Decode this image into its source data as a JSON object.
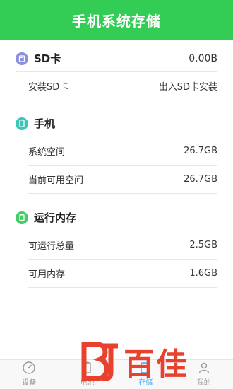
{
  "header": {
    "title": "手机系统存储"
  },
  "sections": [
    {
      "title": "SD卡",
      "value": "0.00B",
      "icon": "sd-card-icon",
      "icon_color": "#8c8fe0",
      "rows": [
        {
          "label": "安装SD卡",
          "value": "出入SD卡安装"
        }
      ]
    },
    {
      "title": "手机",
      "value": "",
      "icon": "phone-icon",
      "icon_color": "#3ec6b8",
      "rows": [
        {
          "label": "系统空间",
          "value": "26.7GB"
        },
        {
          "label": "当前可用空间",
          "value": "26.7GB"
        }
      ]
    },
    {
      "title": "运行内存",
      "value": "",
      "icon": "memory-icon",
      "icon_color": "#44cc66",
      "rows": [
        {
          "label": "可运行总量",
          "value": "2.5GB"
        },
        {
          "label": "可用内存",
          "value": "1.6GB"
        }
      ]
    }
  ],
  "tabbar": {
    "tabs": [
      {
        "label": "设备",
        "icon": "dashboard-icon",
        "active": false
      },
      {
        "label": "电池",
        "icon": "battery-icon",
        "active": false
      },
      {
        "label": "存储",
        "icon": "storage-icon",
        "active": true
      },
      {
        "label": "我的",
        "icon": "user-icon",
        "active": false
      }
    ]
  },
  "watermark": {
    "text": "百佳",
    "logo_text": "BJ"
  }
}
